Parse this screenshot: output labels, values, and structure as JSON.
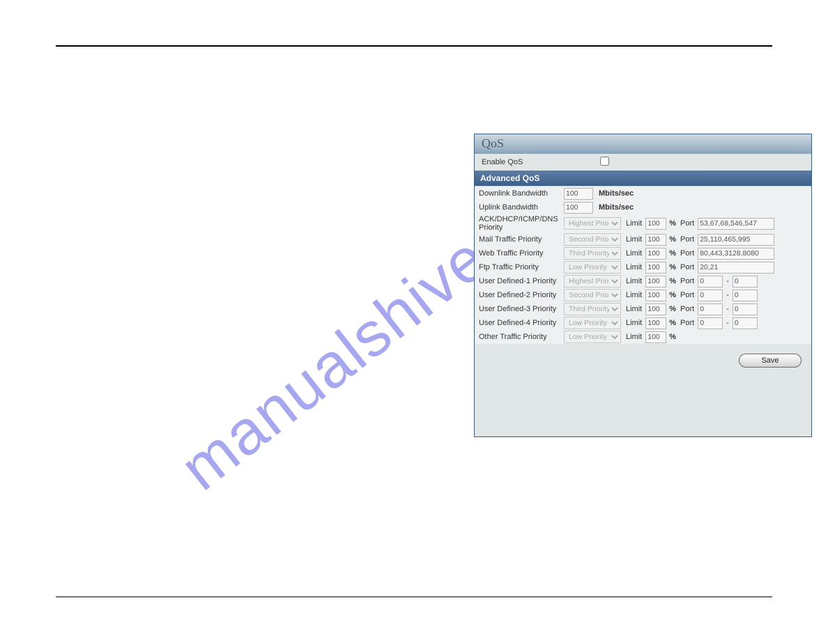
{
  "watermark": "manualshive.com",
  "panel": {
    "title": "QoS",
    "enable_label": "Enable QoS",
    "enable_checked": false,
    "section_title": "Advanced QoS",
    "bandwidth": {
      "down_label": "Downlink Bandwidth",
      "down_value": "100",
      "up_label": "Uplink Bandwidth",
      "up_value": "100",
      "unit": "Mbits/sec"
    },
    "labels": {
      "limit": "Limit",
      "percent": "%",
      "port": "Port",
      "dash": "-"
    },
    "priority_options": [
      "Highest Priority",
      "Second Priority",
      "Third Priority",
      "Low Priority"
    ],
    "rows": [
      {
        "label": "ACK/DHCP/ICMP/DNS Priority",
        "priority": "Highest Priority",
        "limit": "100",
        "port": "53,67,68,546,547",
        "port2": null
      },
      {
        "label": "Mail Traffic Priority",
        "priority": "Second Priority",
        "limit": "100",
        "port": "25,110,465,995",
        "port2": null
      },
      {
        "label": "Web Traffic Priority",
        "priority": "Third Priority",
        "limit": "100",
        "port": "80,443,3128,8080",
        "port2": null
      },
      {
        "label": "Ftp Traffic Priority",
        "priority": "Low Priority",
        "limit": "100",
        "port": "20,21",
        "port2": null
      },
      {
        "label": "User Defined-1 Priority",
        "priority": "Highest Priority",
        "limit": "100",
        "port": "0",
        "port2": "0"
      },
      {
        "label": "User Defined-2 Priority",
        "priority": "Second Priority",
        "limit": "100",
        "port": "0",
        "port2": "0"
      },
      {
        "label": "User Defined-3 Priority",
        "priority": "Third Priority",
        "limit": "100",
        "port": "0",
        "port2": "0"
      },
      {
        "label": "User Defined-4 Priority",
        "priority": "Low Priority",
        "limit": "100",
        "port": "0",
        "port2": "0"
      },
      {
        "label": "Other Traffic Priority",
        "priority": "Low Priority",
        "limit": "100",
        "port": null,
        "port2": null
      }
    ],
    "save_label": "Save"
  }
}
